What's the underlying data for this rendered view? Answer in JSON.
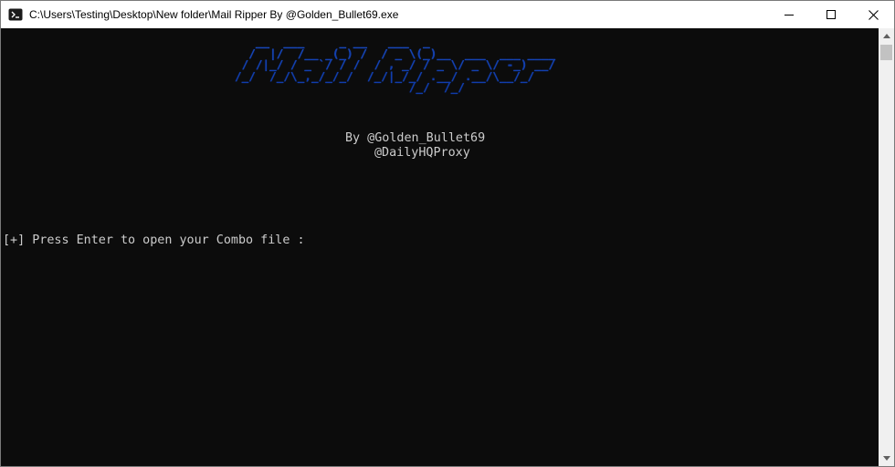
{
  "window": {
    "title": "C:\\Users\\Testing\\Desktop\\New folder\\Mail Ripper By @Golden_Bullet69.exe",
    "icon": "console-app-icon",
    "controls": [
      "minimize-icon",
      "maximize-icon",
      "close-icon"
    ]
  },
  "console": {
    "banner_lines": [
      "   __  ___     _ __   ___  _                     ",
      "  /  |/  /__ _(_) /  / _ \\(_)__  ___  ___ ____  ",
      " / /|_/ / _ `/ / /  / , _/ / _ \\/ _ \\/ -_) __/  ",
      "/_/  /_/\\_,_/_/_/  /_/|_/_/ .__/ .__/\\__/_/     ",
      "                         /_/  /_/                "
    ],
    "by_line": "By @Golden_Bullet69",
    "handle_line": "@DailyHQProxy",
    "prompt": "[+] Press Enter to open your Combo file :"
  },
  "colors": {
    "console_bg": "#0c0c0c",
    "console_text": "#cccccc",
    "banner": "#1f5fe0"
  }
}
